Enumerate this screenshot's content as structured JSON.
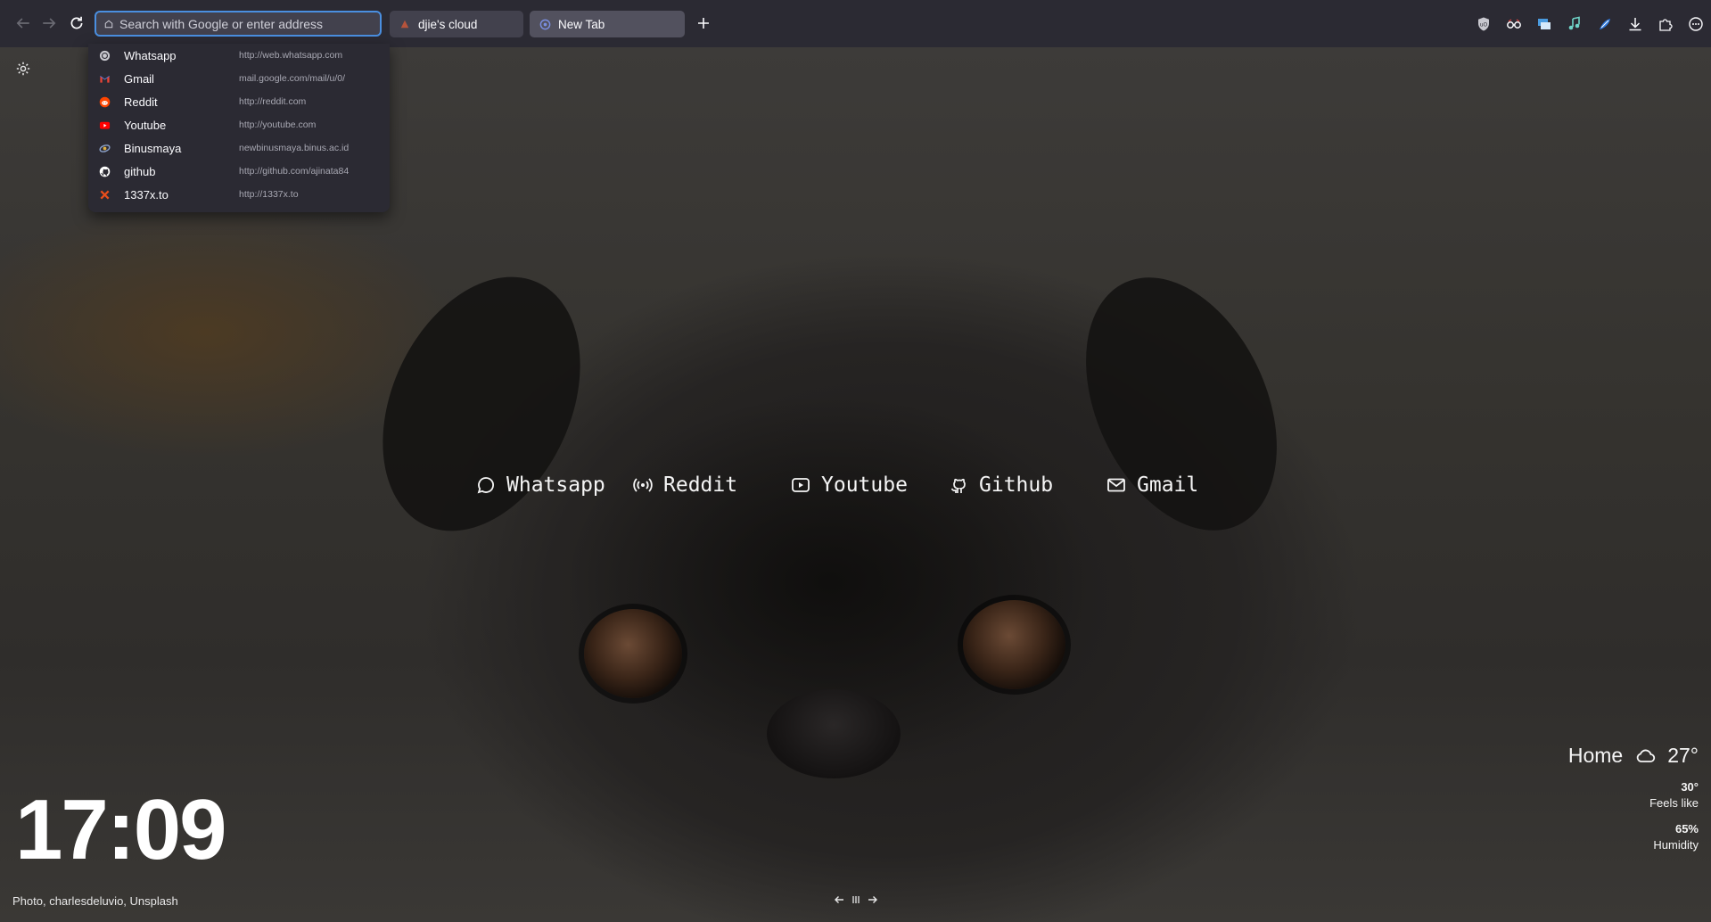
{
  "browser": {
    "url_placeholder": "Search with Google or enter address",
    "tabs": [
      {
        "title": "djie's cloud",
        "active": false
      },
      {
        "title": "New Tab",
        "active": true
      }
    ],
    "extensions": [
      "shield-icon",
      "glasses-icon",
      "sync-icon",
      "music-icon",
      "feather-icon",
      "download-icon",
      "puzzle-icon",
      "menu-icon"
    ]
  },
  "dropdown": {
    "items": [
      {
        "title": "Whatsapp",
        "url": "http://web.whatsapp.com",
        "icon": "whatsapp-icon",
        "color": "#25d366"
      },
      {
        "title": "Gmail",
        "url": "mail.google.com/mail/u/0/",
        "icon": "gmail-icon",
        "color": "#ea4335"
      },
      {
        "title": "Reddit",
        "url": "http://reddit.com",
        "icon": "reddit-icon",
        "color": "#ff4500"
      },
      {
        "title": "Youtube",
        "url": "http://youtube.com",
        "icon": "youtube-icon",
        "color": "#ff0000"
      },
      {
        "title": "Binusmaya",
        "url": "newbinusmaya.binus.ac.id",
        "icon": "binusmaya-icon",
        "color": "#8aa0c8"
      },
      {
        "title": "github",
        "url": "http://github.com/ajinata84",
        "icon": "github-icon",
        "color": "#ffffff"
      },
      {
        "title": "1337x.to",
        "url": "http://1337x.to",
        "icon": "1337x-icon",
        "color": "#e94e1b"
      }
    ]
  },
  "links": [
    {
      "label": "Whatsapp",
      "icon": "chat-bubble-icon"
    },
    {
      "label": "Reddit",
      "icon": "broadcast-icon"
    },
    {
      "label": "Youtube",
      "icon": "play-icon"
    },
    {
      "label": "Github",
      "icon": "github-icon"
    },
    {
      "label": "Gmail",
      "icon": "mail-icon"
    }
  ],
  "clock": {
    "time": "17:09"
  },
  "credit": "Photo, charlesdeluvio, Unsplash",
  "weather": {
    "location": "Home",
    "temp": "27°",
    "feels_like_value": "30°",
    "feels_like_label": "Feels like",
    "humidity_value": "65%",
    "humidity_label": "Humidity",
    "icon": "cloud-icon"
  }
}
